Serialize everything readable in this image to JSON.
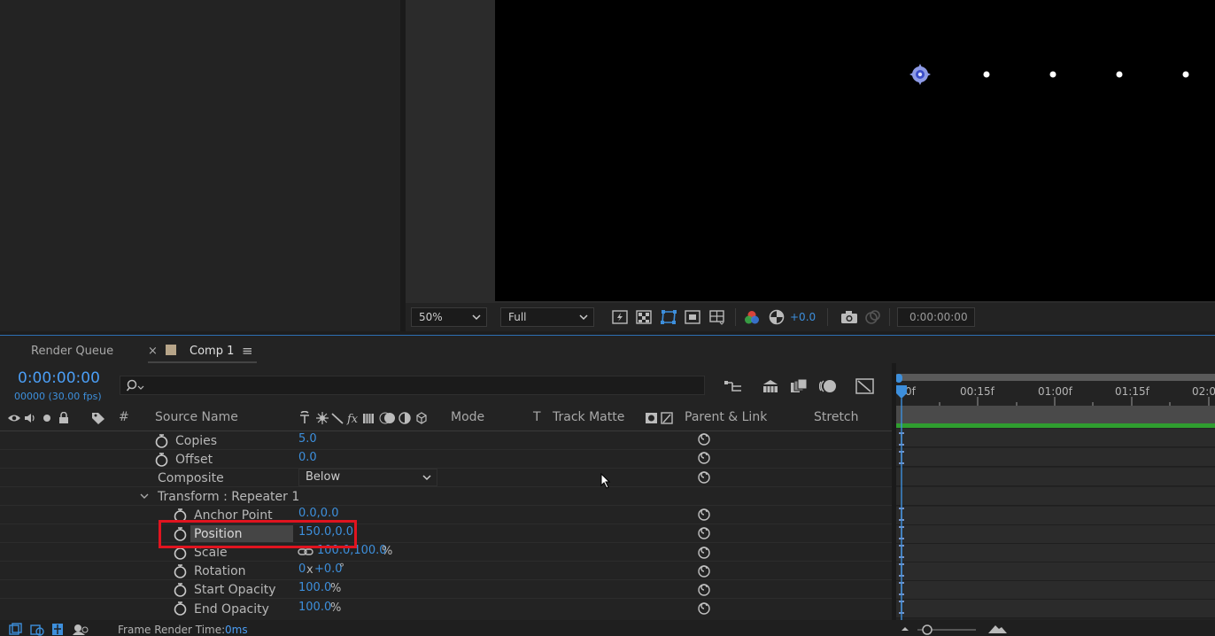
{
  "viewer": {
    "zoom": "50%",
    "resolution": "Full",
    "exposure": "+0.0",
    "timecode": "0:00:00:00"
  },
  "tabs": {
    "render_queue": "Render Queue",
    "comp": "Comp 1",
    "close": "×",
    "menu": "≡"
  },
  "timeline": {
    "current_time": "0:00:00:00",
    "frame_info": "00000 (30.00 fps)",
    "search_placeholder": "",
    "columns": {
      "hash": "#",
      "source_name": "Source Name",
      "mode": "Mode",
      "t": "T",
      "track_matte": "Track Matte",
      "parent_link": "Parent & Link",
      "stretch": "Stretch"
    },
    "ruler": [
      "0f",
      "00:15f",
      "01:00f",
      "01:15f",
      "02:0"
    ]
  },
  "properties": {
    "copies": {
      "label": "Copies",
      "value": "5.0"
    },
    "offset": {
      "label": "Offset",
      "value": "0.0"
    },
    "composite": {
      "label": "Composite",
      "value": "Below"
    },
    "transform": {
      "label": "Transform : Repeater 1"
    },
    "anchor": {
      "label": "Anchor Point",
      "value": "0.0,0.0"
    },
    "position": {
      "label": "Position",
      "value": "150.0,0.0"
    },
    "scale": {
      "label": "Scale",
      "value": "100.0,100.0",
      "unit": "%"
    },
    "rotation": {
      "label": "Rotation",
      "value_x": "0",
      "x": "x",
      "value_deg": "+0.0",
      "unit": "°"
    },
    "start_opacity": {
      "label": "Start Opacity",
      "value": "100.0",
      "unit": "%"
    },
    "end_opacity": {
      "label": "End Opacity",
      "value": "100.0",
      "unit": "%"
    }
  },
  "status": {
    "frame_render_label": "Frame Render Time:",
    "frame_render_value": "0ms"
  },
  "colors": {
    "accent": "#3d8fdc",
    "highlight_box": "#e0141f",
    "work_area_bar": "#2f9e2f",
    "comp_swatch": "#b7a589"
  }
}
